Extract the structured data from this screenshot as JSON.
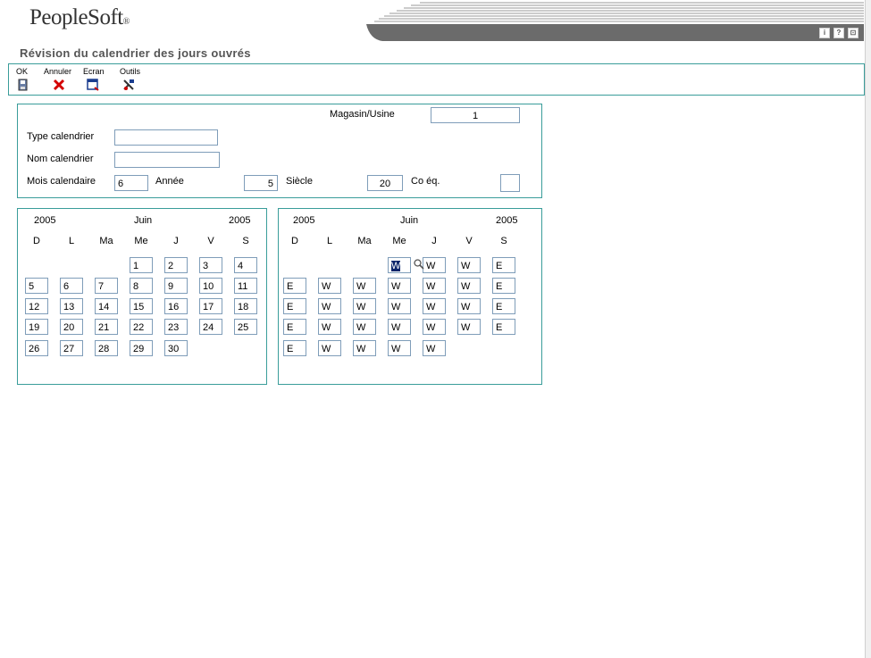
{
  "app": {
    "logo": "PeopleSoft",
    "logo_mark": "®",
    "header_icons": [
      "i",
      "?",
      "⊡"
    ]
  },
  "page": {
    "title": "Révision du calendrier des jours ouvrés"
  },
  "toolbar": {
    "ok": "OK",
    "annuler": "Annuler",
    "ecran": "Ecran",
    "outils": "Outils"
  },
  "header": {
    "magasin_label": "Magasin/Usine",
    "magasin_value": "1",
    "type_label": "Type calendrier",
    "type_value": "",
    "nom_label": "Nom calendrier",
    "nom_value": "",
    "mois_label": "Mois calendaire",
    "mois_value": "6",
    "annee_label": "Année",
    "annee_value": "5",
    "siecle_label": "Siècle",
    "siecle_value": "20",
    "coeq_label": "Co éq.",
    "coeq_value": ""
  },
  "calendar_left": {
    "year_left": "2005",
    "month": "Juin",
    "year_right": "2005",
    "days": [
      "D",
      "L",
      "Ma",
      "Me",
      "J",
      "V",
      "S"
    ],
    "weeks": [
      [
        "",
        "",
        "",
        "1",
        "2",
        "3",
        "4"
      ],
      [
        "5",
        "6",
        "7",
        "8",
        "9",
        "10",
        "11"
      ],
      [
        "12",
        "13",
        "14",
        "15",
        "16",
        "17",
        "18"
      ],
      [
        "19",
        "20",
        "21",
        "22",
        "23",
        "24",
        "25"
      ],
      [
        "26",
        "27",
        "28",
        "29",
        "30",
        "",
        ""
      ]
    ]
  },
  "calendar_right": {
    "year_left": "2005",
    "month": "Juin",
    "year_right": "2005",
    "days": [
      "D",
      "L",
      "Ma",
      "Me",
      "J",
      "V",
      "S"
    ],
    "weeks": [
      [
        "",
        "",
        "",
        "W",
        "W",
        "W",
        "E"
      ],
      [
        "E",
        "W",
        "W",
        "W",
        "W",
        "W",
        "E"
      ],
      [
        "E",
        "W",
        "W",
        "W",
        "W",
        "W",
        "E"
      ],
      [
        "E",
        "W",
        "W",
        "W",
        "W",
        "W",
        "E"
      ],
      [
        "E",
        "W",
        "W",
        "W",
        "W",
        "",
        ""
      ]
    ],
    "selected": "0-3"
  }
}
